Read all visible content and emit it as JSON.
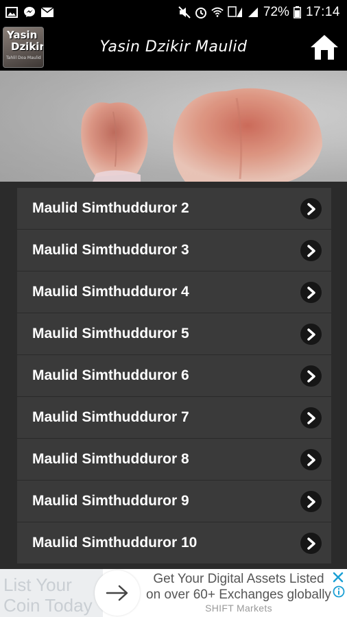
{
  "status_bar": {
    "battery_percent": "72%",
    "time": "17:14",
    "icons_left": [
      "image-icon",
      "messenger-icon",
      "mail-icon"
    ],
    "icons_right": [
      "mute-icon",
      "alarm-icon",
      "wifi-icon",
      "sim-signal-icon",
      "signal-icon",
      "battery-icon"
    ],
    "sim_badge": "1"
  },
  "app_bar": {
    "logo_line1": "Yasin",
    "logo_line2": "Dzikir",
    "logo_line3": "Tahlil Doa Maulid",
    "title": "Yasin Dzikir Maulid",
    "home_icon": "home-icon"
  },
  "list": {
    "items": [
      {
        "label": "Maulid Simthudduror 2"
      },
      {
        "label": "Maulid Simthudduror 3"
      },
      {
        "label": "Maulid Simthudduror 4"
      },
      {
        "label": "Maulid Simthudduror 5"
      },
      {
        "label": "Maulid Simthudduror 6"
      },
      {
        "label": "Maulid Simthudduror 7"
      },
      {
        "label": "Maulid Simthudduror 8"
      },
      {
        "label": "Maulid Simthudduror 9"
      },
      {
        "label": "Maulid Simthudduror 10"
      }
    ],
    "chevron_icon": "chevron-right-icon"
  },
  "ad": {
    "left_line1": "List Your",
    "left_line2": "Coin Today",
    "headline": "Get Your Digital Assets Listed on over 60+ Exchanges globally",
    "advertiser": "SHIFT Markets",
    "accent": "#1a9fd4"
  },
  "colors": {
    "background": "#2b2b2b",
    "list_item": "#3a3a3a",
    "app_bar": "#000000"
  }
}
